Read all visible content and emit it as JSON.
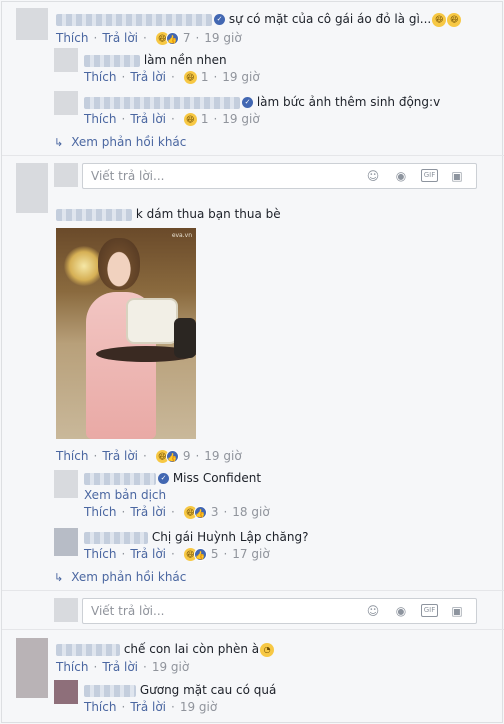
{
  "actions": {
    "like": "Thích",
    "reply": "Trả lời"
  },
  "comments": [
    {
      "text": "sự có mặt của cô gái áo đỏ là gì...",
      "count": "7",
      "time": "19 giờ"
    },
    {
      "text": "làm nền nhen",
      "count": "1",
      "time": "19 giờ"
    },
    {
      "text": "làm bức ảnh thêm sinh động:v",
      "count": "1",
      "time": "19 giờ"
    },
    {
      "text": "k dám thua bạn thua bè",
      "count": "9",
      "time": "19 giờ"
    },
    {
      "text": "Miss Confident",
      "see_translation": "Xem bản dịch",
      "count": "3",
      "time": "18 giờ"
    },
    {
      "text": "Chị gái Huỳnh Lập chăng?",
      "count": "5",
      "time": "17 giờ"
    },
    {
      "text": "chế con lai còn phèn à",
      "time": "19 giờ"
    },
    {
      "text": "Gương mặt cau có quá",
      "time": "19 giờ"
    }
  ],
  "more_replies": "Xem phản hồi khác",
  "reply_placeholder": "Viết trả lời...",
  "photo_watermark": "eva.vn",
  "icons": {
    "emoji": "smiley-icon",
    "camera": "camera-icon",
    "gif": "gif-icon",
    "sticker": "sticker-icon",
    "verified": "verified-badge-icon",
    "haha": "haha-reaction-icon",
    "like": "like-reaction-icon",
    "reply_arrow": "reply-arrow-icon"
  },
  "gif_label": "GIF",
  "colors": {
    "link": "#4b67a1",
    "muted": "#90949c",
    "text": "#1d2129",
    "verified": "#4267b2",
    "haha": "#f7c844"
  }
}
